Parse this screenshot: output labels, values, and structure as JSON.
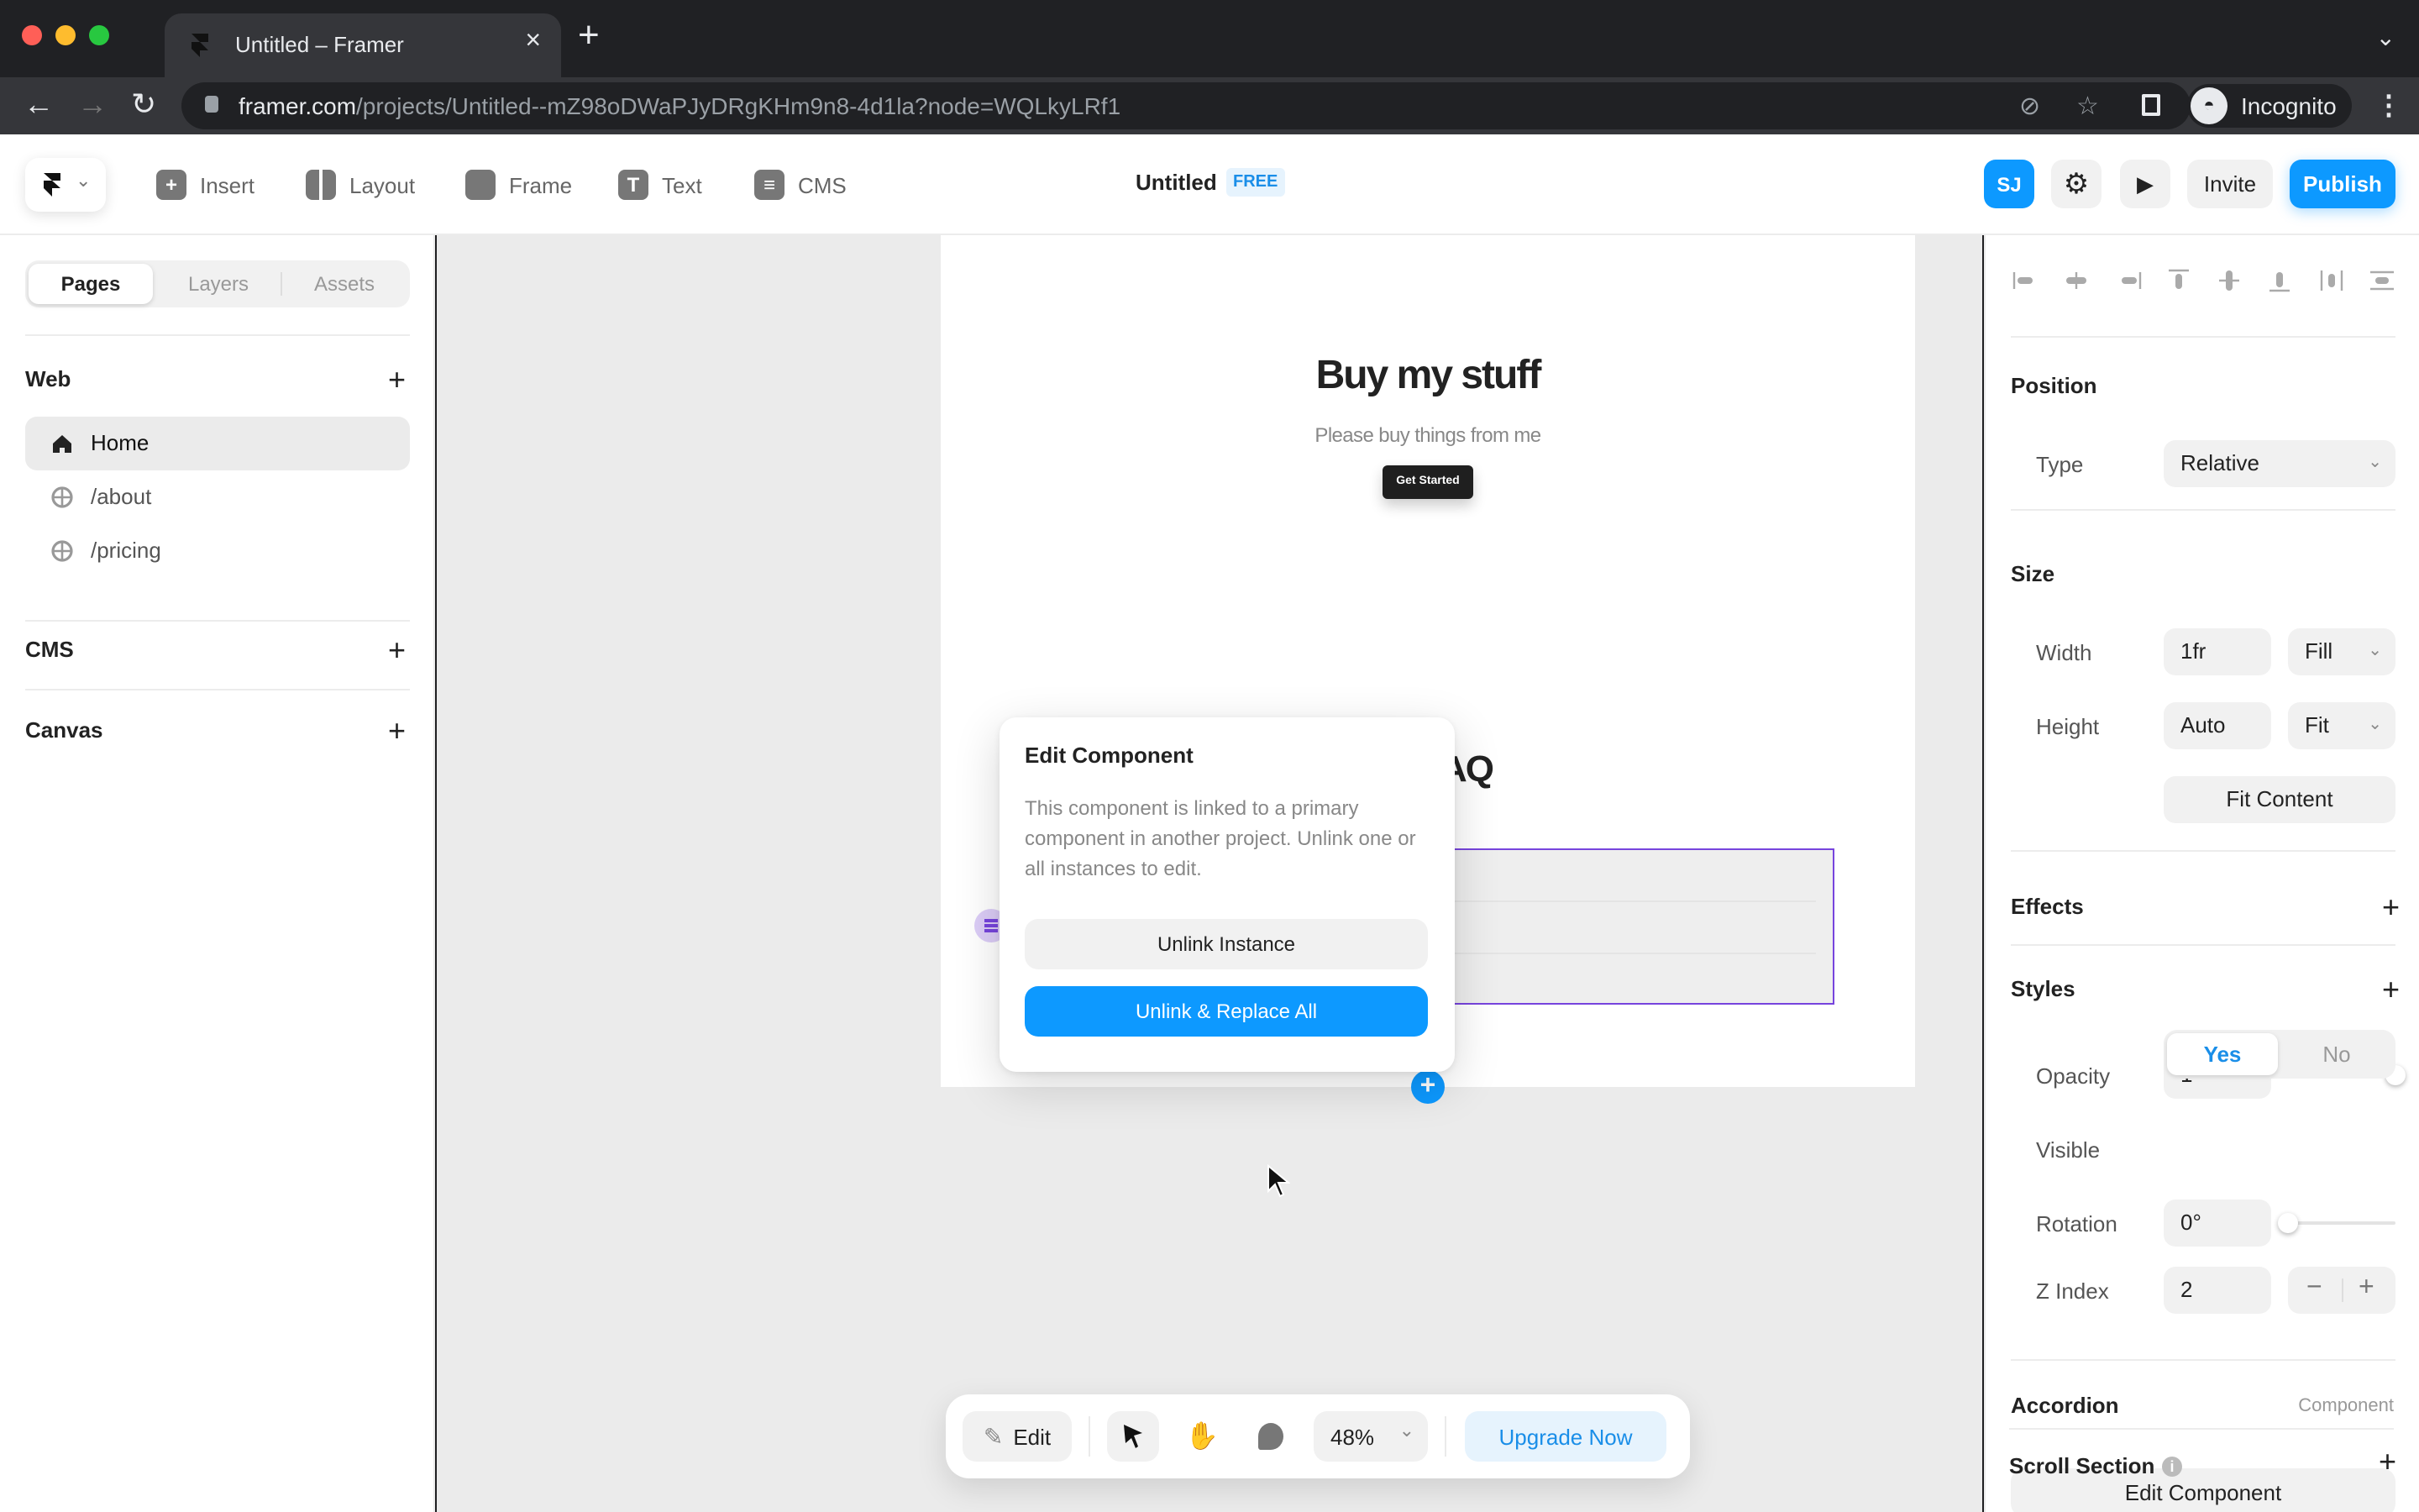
{
  "browser": {
    "tab_title": "Untitled – Framer",
    "close_glyph": "×",
    "new_tab_glyph": "+",
    "tab_menu_glyph": "⌄",
    "url_host": "framer.com",
    "url_path": "/projects/Untitled--mZ98oDWaPJyDRgKHm9n8-4d1la?node=WQLkyLRf1",
    "back_glyph": "←",
    "forward_glyph": "→",
    "reload_glyph": "↻",
    "star_glyph": "☆",
    "eye_glyph": "⊘",
    "profile_label": "Incognito",
    "kebab_glyph": "⋮",
    "traffic_colors": [
      "#ff5f57",
      "#febc2e",
      "#28c840"
    ]
  },
  "topbar": {
    "tools": [
      {
        "label": "Insert",
        "icon": "plus-square-icon",
        "glyph": "+"
      },
      {
        "label": "Layout",
        "icon": "layout-icon",
        "glyph": ""
      },
      {
        "label": "Frame",
        "icon": "frame-icon",
        "glyph": ""
      },
      {
        "label": "Text",
        "icon": "text-icon",
        "glyph": "T"
      },
      {
        "label": "CMS",
        "icon": "database-icon",
        "glyph": "≡"
      }
    ],
    "project_title": "Untitled",
    "plan_badge": "FREE",
    "avatar_initials": "SJ",
    "invite_label": "Invite",
    "publish_label": "Publish",
    "accent": "#0d99ff"
  },
  "left_panel": {
    "tabs": [
      {
        "label": "Pages",
        "active": true
      },
      {
        "label": "Layers",
        "active": false
      },
      {
        "label": "Assets",
        "active": false
      }
    ],
    "sections": {
      "web": "Web",
      "cms": "CMS",
      "canvas": "Canvas"
    },
    "pages": [
      {
        "label": "Home",
        "icon": "home-icon",
        "active": true
      },
      {
        "label": "/about",
        "icon": "globe-icon",
        "active": false
      },
      {
        "label": "/pricing",
        "icon": "globe-icon",
        "active": false
      }
    ],
    "plus_glyph": "+"
  },
  "canvas": {
    "hero_title": "Buy my stuff",
    "hero_subtitle": "Please buy things from me",
    "hero_button": "Get Started",
    "faq_title_visible": "AQ",
    "add_glyph": "+",
    "selection_color": "#7744dd"
  },
  "popover": {
    "title": "Edit Component",
    "body": "This component is linked to a primary component in another project. Unlink one or all instances to edit.",
    "unlink_instance": "Unlink Instance",
    "unlink_replace_all": "Unlink & Replace All"
  },
  "bottom_toolbar": {
    "edit_label": "Edit",
    "zoom_value": "48%",
    "upgrade_label": "Upgrade Now",
    "chevron_glyph": "⌄"
  },
  "right_panel": {
    "position": {
      "title": "Position",
      "type_label": "Type",
      "type_value": "Relative"
    },
    "size": {
      "title": "Size",
      "width_label": "Width",
      "width_value": "1fr",
      "width_mode": "Fill",
      "height_label": "Height",
      "height_value": "Auto",
      "height_mode": "Fit",
      "fit_content": "Fit Content"
    },
    "effects": {
      "title": "Effects"
    },
    "styles": {
      "title": "Styles",
      "opacity_label": "Opacity",
      "opacity_value": "1",
      "opacity_fraction": 1.0,
      "visible_label": "Visible",
      "visible_yes": "Yes",
      "visible_no": "No",
      "visible_selected": "Yes",
      "rotation_label": "Rotation",
      "rotation_value": "0°",
      "rotation_fraction": 0.0,
      "zindex_label": "Z Index",
      "zindex_value": "2",
      "minus_glyph": "−",
      "plus_glyph": "+"
    },
    "component": {
      "title": "Accordion",
      "kind": "Component",
      "edit_button": "Edit Component"
    },
    "scroll_section": {
      "title": "Scroll Section",
      "info_glyph": "i"
    },
    "plus_glyph": "+",
    "dropdown_glyph": "⌄"
  }
}
